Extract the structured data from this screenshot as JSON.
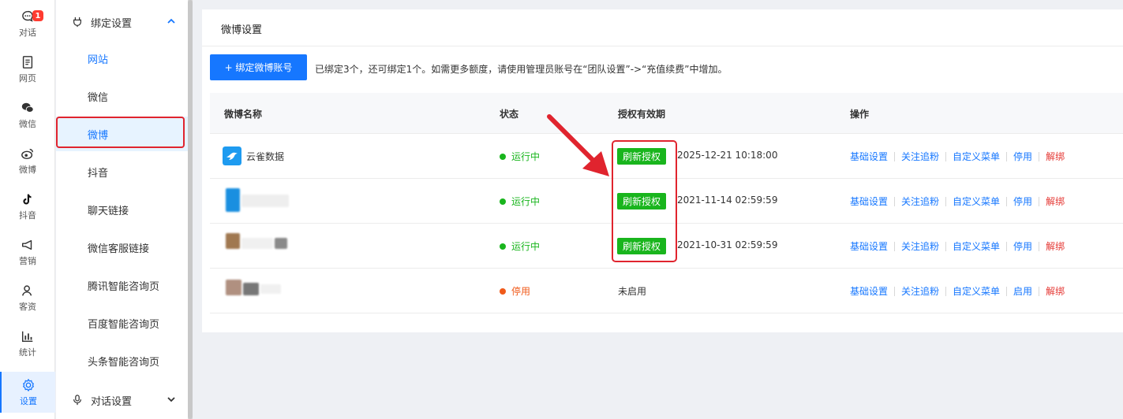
{
  "rail": {
    "items": [
      {
        "label": "对话",
        "icon": "chat-bubble-icon",
        "badge": "1"
      },
      {
        "label": "网页",
        "icon": "document-icon"
      },
      {
        "label": "微信",
        "icon": "wechat-icon"
      },
      {
        "label": "微博",
        "icon": "weibo-icon"
      },
      {
        "label": "抖音",
        "icon": "douyin-icon"
      },
      {
        "label": "营销",
        "icon": "megaphone-icon"
      },
      {
        "label": "客资",
        "icon": "users-icon"
      },
      {
        "label": "统计",
        "icon": "bar-chart-icon"
      },
      {
        "label": "设置",
        "icon": "gear-icon",
        "active": true
      }
    ]
  },
  "menu": {
    "group_title": "绑定设置",
    "items": [
      "网站",
      "微信",
      "微博",
      "抖音",
      "聊天链接",
      "微信客服链接",
      "腾讯智能咨询页",
      "百度智能咨询页",
      "头条智能咨询页"
    ],
    "active_item": "微博",
    "next_group_title": "对话设置"
  },
  "main": {
    "title": "微博设置",
    "bind_button": "+ 绑定微博账号",
    "bind_note": "已绑定3个，还可绑定1个。如需更多额度，请使用管理员账号在“团队设置”->“充值续费”中增加。",
    "columns": [
      "微博名称",
      "状态",
      "授权有效期",
      "操作"
    ],
    "rows": [
      {
        "name": "云雀数据",
        "status": "运行中",
        "status_color": "#19b51d",
        "refresh": "刷新授权",
        "validity": "2025-12-21 10:18:00",
        "ops": [
          "基础设置",
          "关注追粉",
          "自定义菜单",
          "停用",
          "解绑"
        ]
      },
      {
        "name": "",
        "status": "运行中",
        "status_color": "#19b51d",
        "refresh": "刷新授权",
        "validity": "2021-11-14 02:59:59",
        "ops": [
          "基础设置",
          "关注追粉",
          "自定义菜单",
          "停用",
          "解绑"
        ]
      },
      {
        "name": "",
        "status": "运行中",
        "status_color": "#19b51d",
        "refresh": "刷新授权",
        "validity": "2021-10-31 02:59:59",
        "ops": [
          "基础设置",
          "关注追粉",
          "自定义菜单",
          "停用",
          "解绑"
        ]
      },
      {
        "name": "",
        "status": "停用",
        "status_color": "#f05a1a",
        "refresh": "",
        "validity": "未启用",
        "ops": [
          "基础设置",
          "关注追粉",
          "自定义菜单",
          "启用",
          "解绑"
        ]
      }
    ]
  },
  "colors": {
    "accent": "#1677ff",
    "success": "#19b51d",
    "danger": "#e53935",
    "annotation": "#e0242e"
  }
}
